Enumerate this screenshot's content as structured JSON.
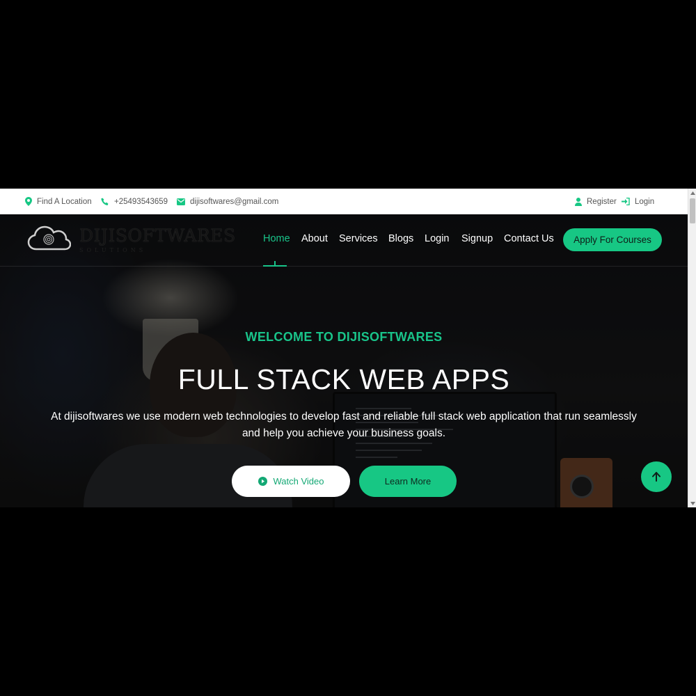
{
  "topbar": {
    "location": "Find A Location",
    "phone": "+25493543659",
    "email": "dijisoftwares@gmail.com",
    "register": "Register",
    "login": "Login"
  },
  "logo": {
    "name": "DIJISOFTWARES",
    "tagline": "SOLUTIONS"
  },
  "nav": {
    "items": [
      {
        "label": "Home",
        "active": true
      },
      {
        "label": "About"
      },
      {
        "label": "Services"
      },
      {
        "label": "Blogs"
      },
      {
        "label": "Login"
      },
      {
        "label": "Signup"
      },
      {
        "label": "Contact Us"
      }
    ],
    "cta": "Apply For Courses"
  },
  "hero": {
    "welcome": "WELCOME TO DIJISOFTWARES",
    "title": "FULL STACK WEB APPS",
    "description": "At dijisoftwares we use modern web technologies to develop fast and reliable full stack web application that run seamlessly and help you achieve your business goals.",
    "watch_label": "Watch Video",
    "learn_label": "Learn More"
  },
  "colors": {
    "accent": "#17c784",
    "background": "#1b1b1b",
    "topbar": "#ffffff"
  },
  "icons": {
    "location": "map-pin-icon",
    "phone": "phone-icon",
    "email": "envelope-icon",
    "register": "user-icon",
    "login": "sign-in-icon",
    "play": "play-circle-icon",
    "back_to_top": "arrow-up-icon"
  }
}
